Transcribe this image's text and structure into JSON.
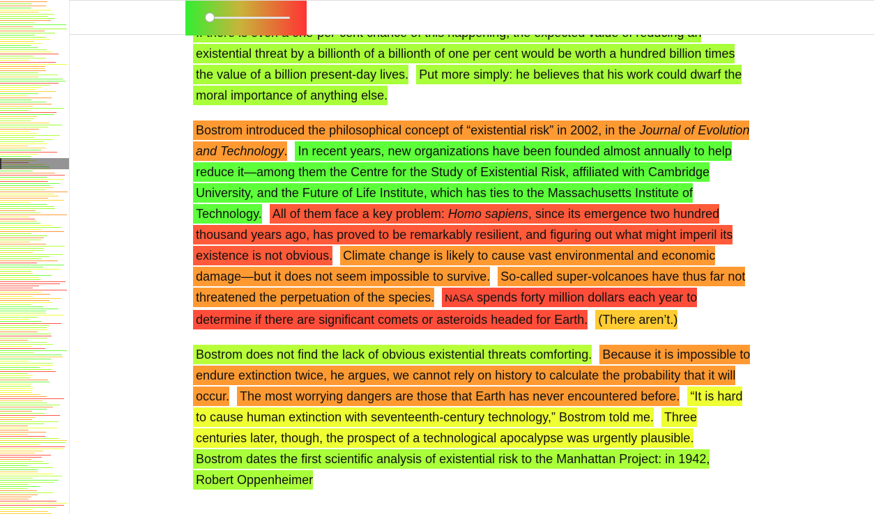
{
  "slider": {
    "value": 0.05,
    "gradient_start": "#33ee33",
    "gradient_end": "#ff3333"
  },
  "minimap": {
    "palette": [
      "#b5ff3a",
      "#9dff2f",
      "#f0ff3a",
      "#ff9a3a",
      "#ff5544",
      "#ffd13a",
      "#6cff3a"
    ]
  },
  "article": {
    "paragraphs": [
      {
        "sentences": [
          {
            "parts": [
              {
                "text": "If there is even a one-per-cent chance of this happening, the expected value of reducing an existential threat by a billionth of a billionth of one per cent would be worth a hundred billion times the value of a billion present-day lives."
              }
            ],
            "color": "#a8ff3a"
          },
          {
            "parts": [
              {
                "text": "Put more simply: he believes that his work could dwarf the moral importance of anything else."
              }
            ],
            "color": "#a8ff3a"
          }
        ]
      },
      {
        "sentences": [
          {
            "parts": [
              {
                "text": "Bostrom introduced the philosophical concept of “existential risk” in 2002, in the "
              },
              {
                "text": "Journal of Evolution and Technology",
                "style": "italic"
              },
              {
                "text": "."
              }
            ],
            "color": "#ff9a33"
          },
          {
            "parts": [
              {
                "text": "In recent years, new organizations have been founded almost annually to help reduce it—among them the Centre for the Study of Existential Risk, affiliated with Cambridge University, and the Future of Life Institute, which has ties to the Massachusetts Institute of Technology."
              }
            ],
            "color": "#5cff3a"
          },
          {
            "parts": [
              {
                "text": "All of them face a key problem: "
              },
              {
                "text": "Homo sapiens",
                "style": "italic"
              },
              {
                "text": ", since its emergence two hundred thousand years ago, has proved to be remarkably resilient, and figuring out what might imperil its existence is not obvious."
              }
            ],
            "color": "#ff5a3a"
          },
          {
            "parts": [
              {
                "text": "Climate change is likely to cause vast environmental and economic damage—but it does not seem impossible to survive."
              }
            ],
            "color": "#ff9a33"
          },
          {
            "parts": [
              {
                "text": "So-called super-volcanoes have thus far not threatened the perpetuation of the species."
              }
            ],
            "color": "#ff9a33"
          },
          {
            "parts": [
              {
                "text": "NASA",
                "style": "smallcaps"
              },
              {
                "text": " spends forty million dollars each year to determine if there are significant comets or asteroids headed for Earth."
              }
            ],
            "color": "#ff4d3a"
          },
          {
            "parts": [
              {
                "text": "(There aren’t.)"
              }
            ],
            "color": "#ffcc33"
          }
        ]
      },
      {
        "sentences": [
          {
            "parts": [
              {
                "text": "Bostrom does not find the lack of obvious existential threats comforting."
              }
            ],
            "color": "#b8ff3a"
          },
          {
            "parts": [
              {
                "text": "Because it is impossible to endure extinction twice, he argues, we cannot rely on history to calculate the probability that it will occur."
              }
            ],
            "color": "#ff9a33"
          },
          {
            "parts": [
              {
                "text": "The most worrying dangers are those that Earth has never encountered before."
              }
            ],
            "color": "#ff9a33"
          },
          {
            "parts": [
              {
                "text": "“It is hard to cause human extinction with seventeenth-century technology,” Bostrom told me."
              }
            ],
            "color": "#eeff33"
          },
          {
            "parts": [
              {
                "text": "Three centuries later, though, the prospect of a technological apocalypse was urgently plausible."
              }
            ],
            "color": "#eeff33"
          },
          {
            "parts": [
              {
                "text": "Bostrom dates the first scientific analysis of existential risk to the Manhattan Project: in 1942, Robert Oppenheimer"
              }
            ],
            "color": "#a8ff3a"
          }
        ]
      }
    ]
  }
}
